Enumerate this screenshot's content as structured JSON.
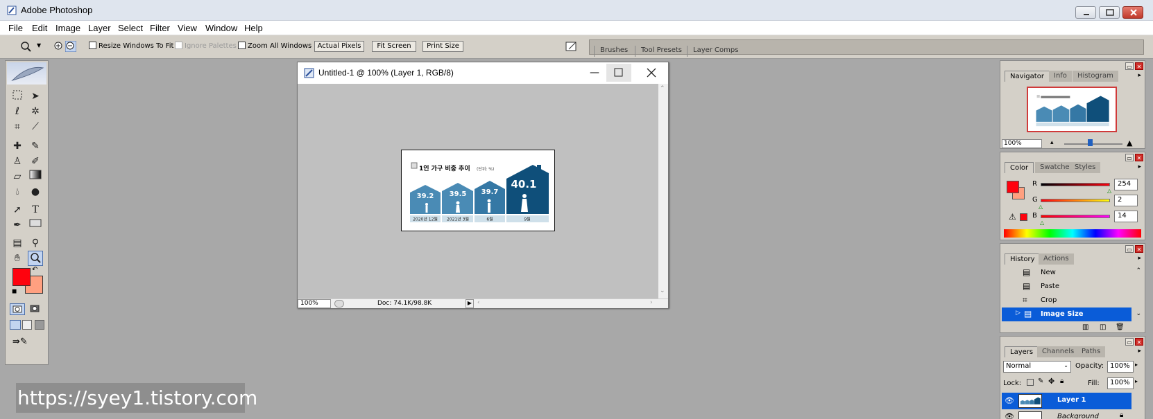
{
  "app": {
    "title": "Adobe Photoshop",
    "logo_icon": "photoshop-feather-icon"
  },
  "menu": [
    "File",
    "Edit",
    "Image",
    "Layer",
    "Select",
    "Filter",
    "View",
    "Window",
    "Help"
  ],
  "options_bar": {
    "checkbox_resize": "Resize Windows To Fit",
    "checkbox_ignore": "Ignore Palettes",
    "checkbox_zoom_all": "Zoom All Windows",
    "btn_actual": "Actual Pixels",
    "btn_fit": "Fit Screen",
    "btn_print": "Print Size"
  },
  "palette_well": [
    "Brushes",
    "Tool Presets",
    "Layer Comps"
  ],
  "document": {
    "title": "Untitled-1 @ 100% (Layer 1, RGB/8)",
    "zoom": "100%",
    "doc_size": "Doc: 74.1K/98.8K"
  },
  "artwork": {
    "heading": "1인 가구 비중 추이",
    "unit": "(단위: %)",
    "houses": [
      {
        "value": "39.2",
        "label": "2020년 12월"
      },
      {
        "value": "39.5",
        "label": "2021년 3월"
      },
      {
        "value": "39.7",
        "label": "6월"
      },
      {
        "value": "40.1",
        "label": "9월"
      }
    ]
  },
  "navigator": {
    "tabs": [
      "Navigator",
      "Info",
      "Histogram"
    ],
    "zoom": "100%"
  },
  "color": {
    "tabs": [
      "Color",
      "Swatches",
      "Styles"
    ],
    "r_label": "R",
    "r": "254",
    "g_label": "G",
    "g": "2",
    "b_label": "B",
    "b": "14",
    "foreground": "#fe020e",
    "background": "#ffa080"
  },
  "history": {
    "tabs": [
      "History",
      "Actions"
    ],
    "items": [
      {
        "label": "New",
        "icon": "document-icon"
      },
      {
        "label": "Paste",
        "icon": "document-icon"
      },
      {
        "label": "Crop",
        "icon": "crop-icon"
      },
      {
        "label": "Image Size",
        "icon": "image-size-icon"
      }
    ]
  },
  "layers": {
    "tabs": [
      "Layers",
      "Channels",
      "Paths"
    ],
    "blend_mode": "Normal",
    "opacity_label": "Opacity:",
    "opacity": "100%",
    "lock_label": "Lock:",
    "fill_label": "Fill:",
    "fill": "100%",
    "items": [
      "Layer 1",
      "Background"
    ]
  },
  "watermark": "https://syey1.tistory.com"
}
